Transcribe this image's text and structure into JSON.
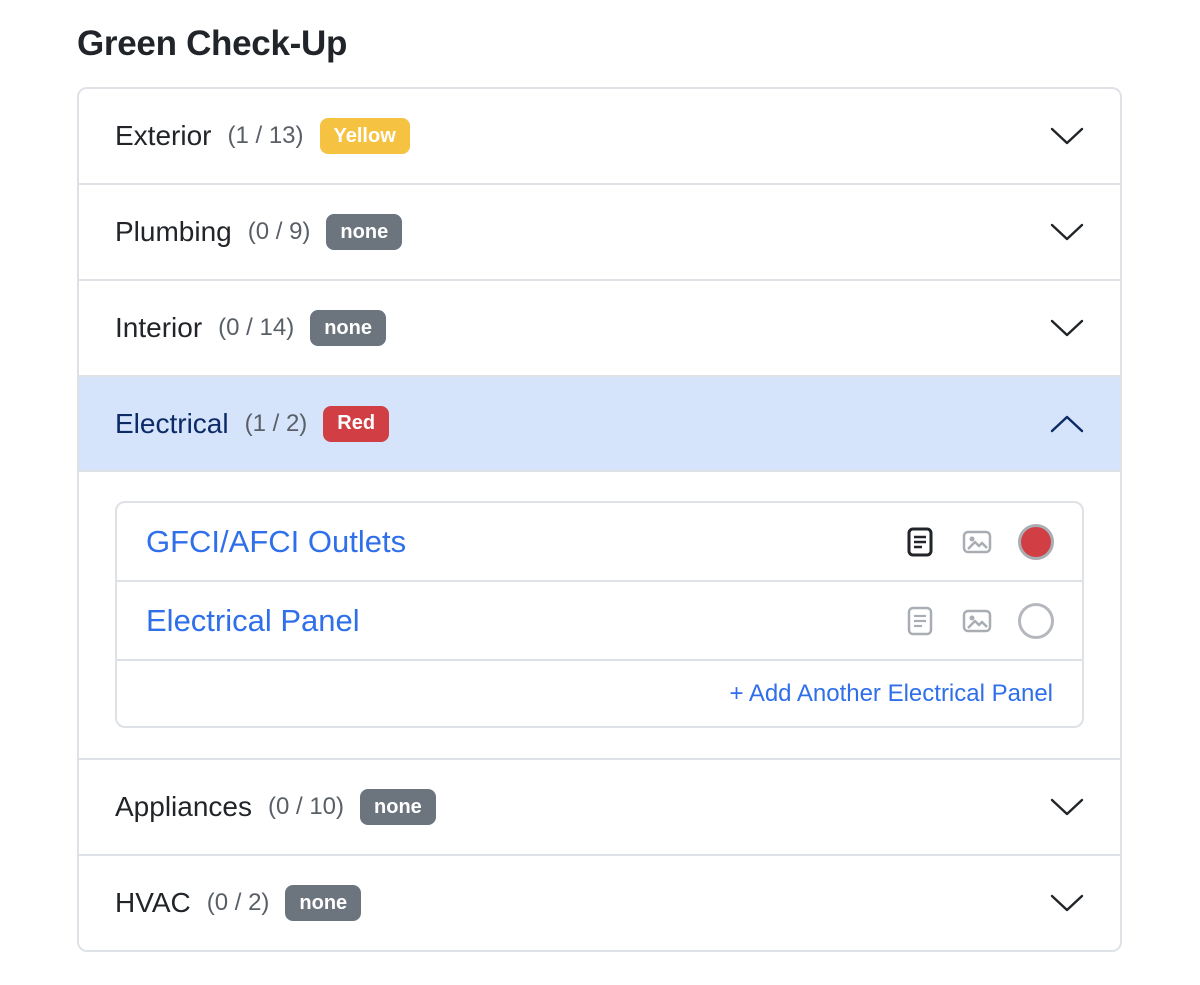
{
  "page": {
    "title": "Green Check-Up"
  },
  "colors": {
    "accent": "#2f6fea",
    "active_header": "#d6e4fb",
    "badge_yellow": "#f5c242",
    "badge_grey": "#6c757d",
    "badge_red": "#d13f45"
  },
  "sections": [
    {
      "name": "Exterior",
      "count": "(1 / 13)",
      "badge": "Yellow",
      "expanded": false
    },
    {
      "name": "Plumbing",
      "count": "(0 / 9)",
      "badge": "none",
      "expanded": false
    },
    {
      "name": "Interior",
      "count": "(0 / 14)",
      "badge": "none",
      "expanded": false
    },
    {
      "name": "Electrical",
      "count": "(1 / 2)",
      "badge": "Red",
      "expanded": true,
      "items": [
        {
          "label": "GFCI/AFCI Outlets",
          "notes_icon": "notes-icon",
          "photo_icon": "photo-icon",
          "status": "red"
        },
        {
          "label": "Electrical Panel",
          "notes_icon": "notes-icon",
          "photo_icon": "photo-icon",
          "status": "empty"
        }
      ],
      "add_label": "+ Add Another Electrical Panel"
    },
    {
      "name": "Appliances",
      "count": "(0 / 10)",
      "badge": "none",
      "expanded": false
    },
    {
      "name": "HVAC",
      "count": "(0 / 2)",
      "badge": "none",
      "expanded": false
    }
  ]
}
